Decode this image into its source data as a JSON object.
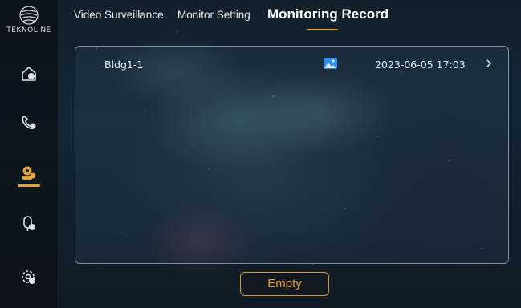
{
  "brand": {
    "name": "TEKNOLINE",
    "logo_icon": "globe-lines-icon"
  },
  "sidebar": {
    "items": [
      {
        "name": "home",
        "icon": "home-icon"
      },
      {
        "name": "call",
        "icon": "phone-icon"
      },
      {
        "name": "monitor",
        "icon": "camera-icon",
        "active": true
      },
      {
        "name": "intercom",
        "icon": "intercom-icon"
      },
      {
        "name": "settings",
        "icon": "gear-icon"
      }
    ],
    "active_color": "#e0a33a"
  },
  "tabs": [
    {
      "label": "Video Surveillance"
    },
    {
      "label": "Monitor Setting"
    },
    {
      "label": "Monitoring Record",
      "active": true
    }
  ],
  "records": [
    {
      "name": "Bldg1-1",
      "thumbnail_icon": "image-icon",
      "time": "2023-06-05 17:03",
      "chevron": ">"
    }
  ],
  "actions": {
    "empty_label": "Empty"
  },
  "colors": {
    "accent": "#e0a33a",
    "thumbnail": "#2f8be8"
  }
}
